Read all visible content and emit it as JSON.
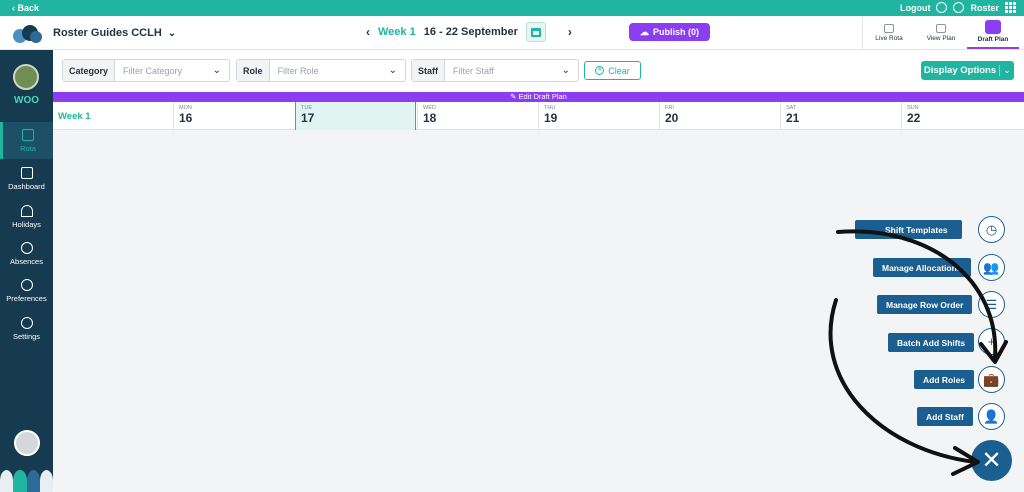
{
  "topbar": {
    "back": "‹ Back",
    "logout": "Logout",
    "user": "Roster"
  },
  "header": {
    "org": "Roster Guides CCLH",
    "week_label": "Week 1",
    "week_range": "16 - 22 September",
    "publish": "Publish (0)",
    "tabs": [
      "Live Rota",
      "View Plan",
      "Draft Plan"
    ]
  },
  "sidebar": {
    "org": "WOO",
    "items": [
      "Rota",
      "Dashboard",
      "Holidays",
      "Absences",
      "Preferences",
      "Settings"
    ]
  },
  "filters": {
    "category_label": "Category",
    "category_placeholder": "Filter Category",
    "role_label": "Role",
    "role_placeholder": "Filter Role",
    "staff_label": "Staff",
    "staff_placeholder": "Filter Staff",
    "clear": "Clear",
    "display_options": "Display Options"
  },
  "banner": "✎ Edit Draft Plan",
  "week": {
    "label": "Week 1",
    "days": [
      {
        "name": "MON",
        "date": "16"
      },
      {
        "name": "TUE",
        "date": "17"
      },
      {
        "name": "WED",
        "date": "18"
      },
      {
        "name": "THU",
        "date": "19"
      },
      {
        "name": "FRI",
        "date": "20"
      },
      {
        "name": "SAT",
        "date": "21"
      },
      {
        "name": "SUN",
        "date": "22"
      }
    ]
  },
  "fab_menu": [
    {
      "label": "Shift Templates",
      "icon": "clock-icon"
    },
    {
      "label": "Manage Allocations",
      "icon": "people-icon"
    },
    {
      "label": "Manage Row Order",
      "icon": "menu-icon"
    },
    {
      "label": "Batch Add Shifts",
      "icon": "plus-icon"
    },
    {
      "label": "Add Roles",
      "icon": "briefcase-icon"
    },
    {
      "label": "Add Staff",
      "icon": "add-user-icon"
    }
  ],
  "fab_close": "✕",
  "colors": {
    "teal": "#1fb5a0",
    "navy": "#163a4f",
    "purple": "#8b3df2",
    "fab_blue": "#1a5f8f"
  }
}
